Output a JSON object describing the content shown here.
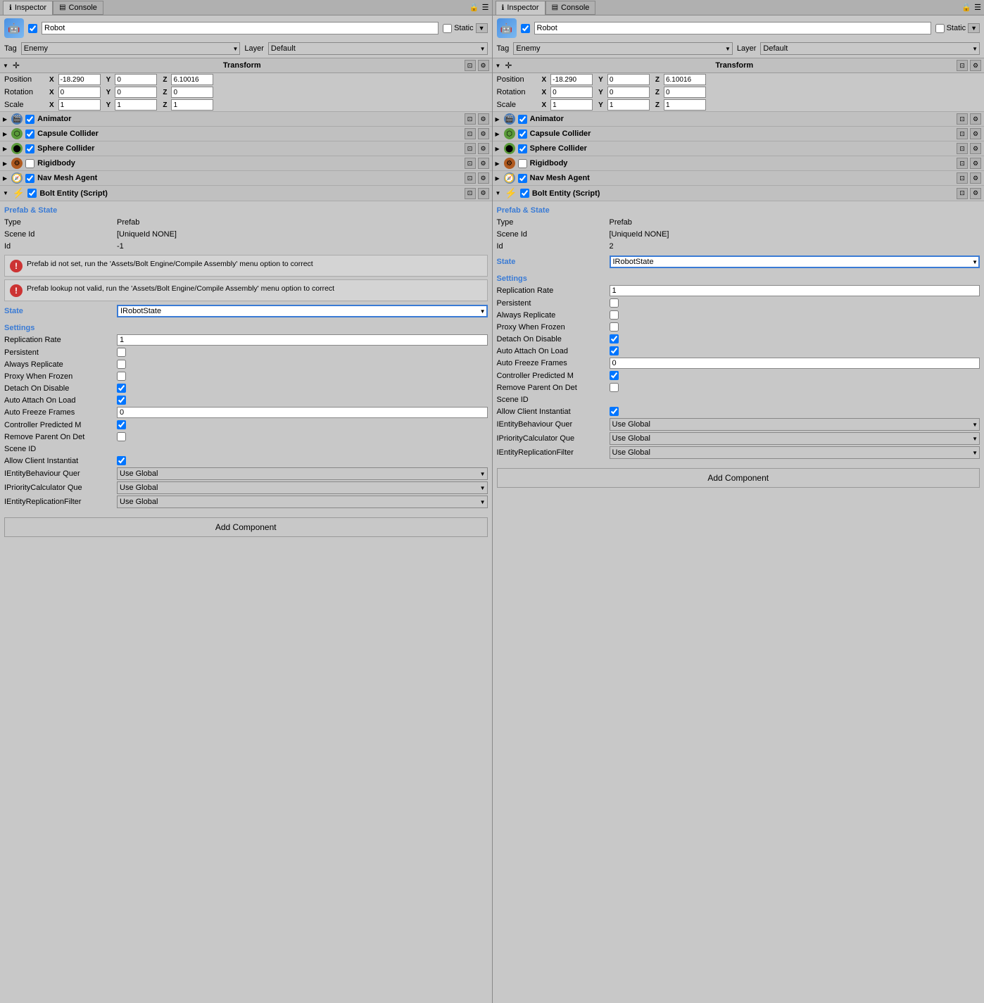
{
  "panels": [
    {
      "id": "left",
      "tabs": [
        {
          "label": "Inspector",
          "active": true,
          "icon": "ℹ"
        },
        {
          "label": "Console",
          "active": false,
          "icon": "▤"
        }
      ],
      "object": {
        "name": "Robot",
        "enabled": true,
        "static": false,
        "tag": "Enemy",
        "layer": "Default"
      },
      "transform": {
        "position": {
          "x": "-18.290",
          "y": "0",
          "z": "6.10016"
        },
        "rotation": {
          "x": "0",
          "y": "0",
          "z": "0"
        },
        "scale": {
          "x": "1",
          "y": "1",
          "z": "1"
        }
      },
      "components": [
        {
          "name": "Animator",
          "enabled": true,
          "icon": "🎬",
          "color": "#4a7ab5"
        },
        {
          "name": "Capsule Collider",
          "enabled": true,
          "icon": "⬡",
          "color": "#5a9a3a"
        },
        {
          "name": "Sphere Collider",
          "enabled": true,
          "icon": "⬤",
          "color": "#5a9a3a"
        },
        {
          "name": "Rigidbody",
          "enabled": false,
          "icon": "⚙",
          "color": "#b05a20"
        }
      ],
      "navMeshAgent": {
        "name": "Nav Mesh Agent",
        "enabled": true
      },
      "boltEntity": {
        "name": "Bolt Entity (Script)",
        "enabled": true,
        "prefabState": {
          "title": "Prefab & State",
          "typeLabel": "Type",
          "typeValue": "Prefab",
          "sceneIdLabel": "Scene Id",
          "sceneIdValue": "[UniqueId NONE]",
          "idLabel": "Id",
          "idValue": "-1"
        },
        "errors": [
          "Prefab id not set, run the 'Assets/Bolt Engine/Compile Assembly' menu option to correct",
          "Prefab lookup not valid, run the 'Assets/Bolt Engine/Compile Assembly' menu option to correct"
        ],
        "stateLabel": "State",
        "stateValue": "IRobotState",
        "stateOptions": [
          "IRobotState"
        ],
        "settings": {
          "title": "Settings",
          "fields": [
            {
              "label": "Replication Rate",
              "type": "input",
              "value": "1"
            },
            {
              "label": "Persistent",
              "type": "checkbox",
              "checked": false
            },
            {
              "label": "Always Replicate",
              "type": "checkbox",
              "checked": false
            },
            {
              "label": "Proxy When Frozen",
              "type": "checkbox",
              "checked": false
            },
            {
              "label": "Detach On Disable",
              "type": "checkbox",
              "checked": true
            },
            {
              "label": "Auto Attach On Load",
              "type": "checkbox",
              "checked": true
            },
            {
              "label": "Auto Freeze Frames",
              "type": "input",
              "value": "0"
            },
            {
              "label": "Controller Predicted M",
              "type": "checkbox",
              "checked": true
            },
            {
              "label": "Remove Parent On Det",
              "type": "checkbox",
              "checked": false
            },
            {
              "label": "Scene ID",
              "type": "none"
            },
            {
              "label": "Allow Client Instantiat",
              "type": "checkbox",
              "checked": true
            },
            {
              "label": "IEntityBehaviour Quer",
              "type": "select",
              "value": "Use Global",
              "options": [
                "Use Global"
              ]
            },
            {
              "label": "IPriorityCalculator Que",
              "type": "select",
              "value": "Use Global",
              "options": [
                "Use Global"
              ]
            },
            {
              "label": "IEntityReplicationFilter",
              "type": "select",
              "value": "Use Global",
              "options": [
                "Use Global"
              ]
            }
          ]
        }
      },
      "addComponentLabel": "Add Component"
    },
    {
      "id": "right",
      "tabs": [
        {
          "label": "Inspector",
          "active": true,
          "icon": "ℹ"
        },
        {
          "label": "Console",
          "active": false,
          "icon": "▤"
        }
      ],
      "object": {
        "name": "Robot",
        "enabled": true,
        "static": false,
        "tag": "Enemy",
        "layer": "Default"
      },
      "transform": {
        "position": {
          "x": "-18.290",
          "y": "0",
          "z": "6.10016"
        },
        "rotation": {
          "x": "0",
          "y": "0",
          "z": "0"
        },
        "scale": {
          "x": "1",
          "y": "1",
          "z": "1"
        }
      },
      "components": [
        {
          "name": "Animator",
          "enabled": true,
          "icon": "🎬",
          "color": "#4a7ab5"
        },
        {
          "name": "Capsule Collider",
          "enabled": true,
          "icon": "⬡",
          "color": "#5a9a3a"
        },
        {
          "name": "Sphere Collider",
          "enabled": true,
          "icon": "⬤",
          "color": "#5a9a3a"
        },
        {
          "name": "Rigidbody",
          "enabled": false,
          "icon": "⚙",
          "color": "#b05a20"
        }
      ],
      "navMeshAgent": {
        "name": "Nav Mesh Agent",
        "enabled": true
      },
      "boltEntity": {
        "name": "Bolt Entity (Script)",
        "enabled": true,
        "prefabState": {
          "title": "Prefab & State",
          "typeLabel": "Type",
          "typeValue": "Prefab",
          "sceneIdLabel": "Scene Id",
          "sceneIdValue": "[UniqueId NONE]",
          "idLabel": "Id",
          "idValue": "2"
        },
        "errors": [],
        "stateLabel": "State",
        "stateValue": "IRobotState",
        "stateOptions": [
          "IRobotState"
        ],
        "settings": {
          "title": "Settings",
          "fields": [
            {
              "label": "Replication Rate",
              "type": "input",
              "value": "1"
            },
            {
              "label": "Persistent",
              "type": "checkbox",
              "checked": false
            },
            {
              "label": "Always Replicate",
              "type": "checkbox",
              "checked": false
            },
            {
              "label": "Proxy When Frozen",
              "type": "checkbox",
              "checked": false
            },
            {
              "label": "Detach On Disable",
              "type": "checkbox",
              "checked": true
            },
            {
              "label": "Auto Attach On Load",
              "type": "checkbox",
              "checked": true
            },
            {
              "label": "Auto Freeze Frames",
              "type": "input",
              "value": "0"
            },
            {
              "label": "Controller Predicted M",
              "type": "checkbox",
              "checked": true
            },
            {
              "label": "Remove Parent On Det",
              "type": "checkbox",
              "checked": false
            },
            {
              "label": "Scene ID",
              "type": "none"
            },
            {
              "label": "Allow Client Instantiat",
              "type": "checkbox",
              "checked": true
            },
            {
              "label": "IEntityBehaviour Quer",
              "type": "select",
              "value": "Use Global",
              "options": [
                "Use Global"
              ]
            },
            {
              "label": "IPriorityCalculator Que",
              "type": "select",
              "value": "Use Global",
              "options": [
                "Use Global"
              ]
            },
            {
              "label": "IEntityReplicationFilter",
              "type": "select",
              "value": "Use Global",
              "options": [
                "Use Global"
              ]
            }
          ]
        }
      },
      "addComponentLabel": "Add Component"
    }
  ]
}
